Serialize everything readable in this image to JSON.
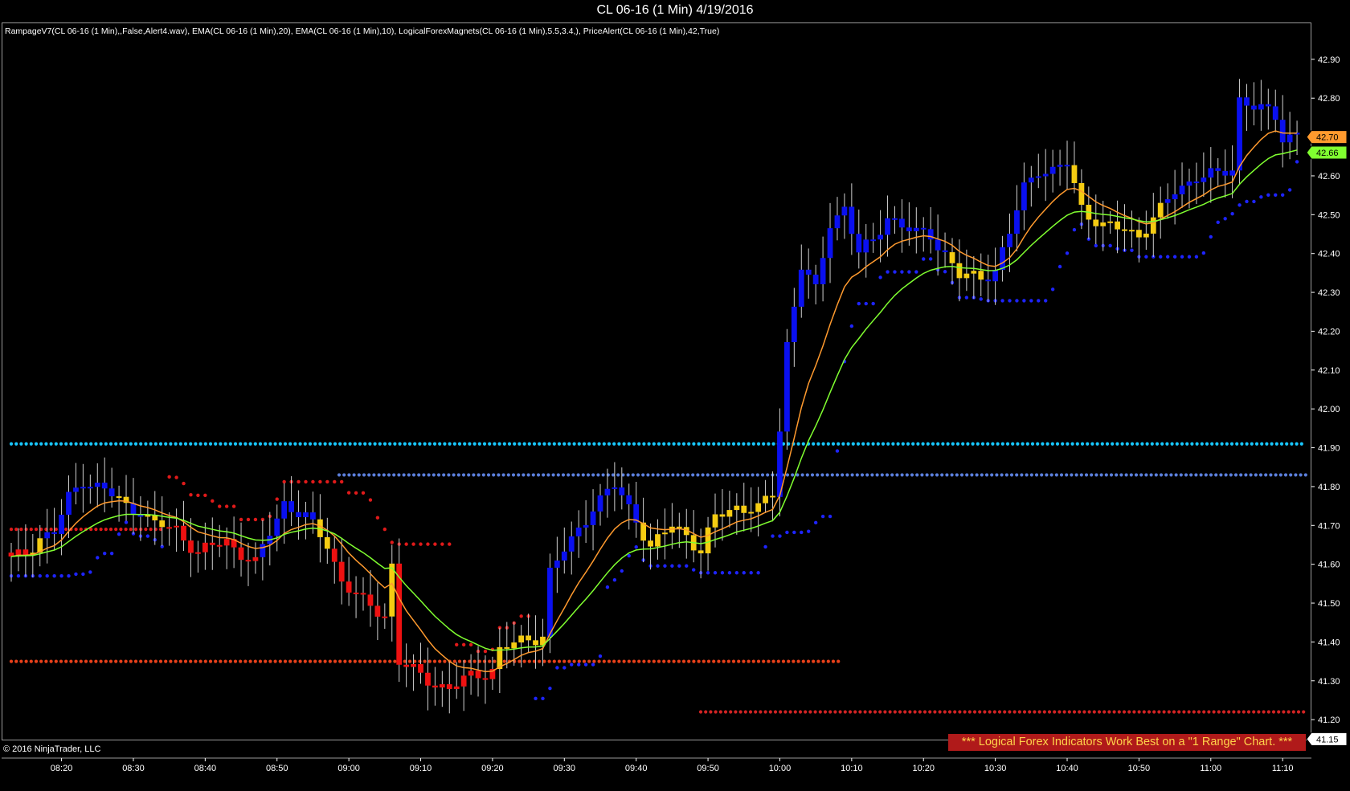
{
  "header": {
    "title": "CL 06-16 (1 Min)  4/19/2016",
    "indicators": "RampageV7(CL 06-16 (1 Min),,False,Alert4.wav), EMA(CL 06-16 (1 Min),20), EMA(CL 06-16 (1 Min),10), LogicalForexMagnets(CL 06-16 (1 Min),5.5,3.4,), PriceAlert(CL 06-16 (1 Min),42,True)"
  },
  "footer": {
    "copyright": "© 2016 NinjaTrader, LLC",
    "banner": "*** Logical Forex Indicators Work Best on a \"1 Range\" Chart. ***"
  },
  "colors": {
    "bull": "#0a10f0",
    "bear": "#ee1111",
    "neutral": "#f5cc12",
    "ema10": "#ff9a2e",
    "ema20": "#80ff30",
    "support_dots": "#1e24ff",
    "resistance_dots": "#e01a1a",
    "magnet_cyan": "#18c8ff",
    "magnet_blue": "#5b7fdc",
    "magnet_red": "#e8401a",
    "magnet_darkred": "#d22323"
  },
  "chart_data": {
    "type": "candlestick",
    "ylim": [
      41.13,
      42.97
    ],
    "y_ticks": [
      "42.90",
      "42.80",
      "42.70",
      "42.60",
      "42.50",
      "42.40",
      "42.30",
      "42.20",
      "42.10",
      "42.00",
      "41.90",
      "41.80",
      "41.70",
      "41.60",
      "41.50",
      "41.40",
      "41.30",
      "41.20"
    ],
    "x_ticks": [
      {
        "label": "08:20",
        "bar": 7
      },
      {
        "label": "08:30",
        "bar": 17
      },
      {
        "label": "08:40",
        "bar": 27
      },
      {
        "label": "08:50",
        "bar": 37
      },
      {
        "label": "09:00",
        "bar": 47
      },
      {
        "label": "09:10",
        "bar": 57
      },
      {
        "label": "09:20",
        "bar": 67
      },
      {
        "label": "09:30",
        "bar": 77
      },
      {
        "label": "09:40",
        "bar": 87
      },
      {
        "label": "09:50",
        "bar": 97
      },
      {
        "label": "10:00",
        "bar": 107
      },
      {
        "label": "10:10",
        "bar": 117
      },
      {
        "label": "10:20",
        "bar": 127
      },
      {
        "label": "10:30",
        "bar": 137
      },
      {
        "label": "10:40",
        "bar": 147
      },
      {
        "label": "10:50",
        "bar": 157
      },
      {
        "label": "11:00",
        "bar": 167
      },
      {
        "label": "11:10",
        "bar": 177
      }
    ],
    "candles_keypoints": [
      [
        0,
        41.61,
        "bear"
      ],
      [
        2,
        41.63,
        "bear"
      ],
      [
        4,
        41.67,
        "neutral"
      ],
      [
        6,
        41.68,
        "bull"
      ],
      [
        8,
        41.77,
        "bull"
      ],
      [
        10,
        41.82,
        "bull"
      ],
      [
        13,
        41.79,
        "bull"
      ],
      [
        16,
        41.75,
        "neutral"
      ],
      [
        18,
        41.74,
        "bull"
      ],
      [
        20,
        41.7,
        "neutral"
      ],
      [
        23,
        41.69,
        "bear"
      ],
      [
        26,
        41.63,
        "bear"
      ],
      [
        30,
        41.66,
        "bear"
      ],
      [
        34,
        41.6,
        "bear"
      ],
      [
        36,
        41.68,
        "bull"
      ],
      [
        38,
        41.76,
        "bull"
      ],
      [
        41,
        41.72,
        "bull"
      ],
      [
        44,
        41.65,
        "neutral"
      ],
      [
        46,
        41.56,
        "bear"
      ],
      [
        49,
        41.5,
        "bear"
      ],
      [
        52,
        41.47,
        "bear"
      ],
      [
        53,
        41.6,
        "neutral"
      ],
      [
        54,
        41.35,
        "bear"
      ],
      [
        57,
        41.31,
        "bear"
      ],
      [
        61,
        41.28,
        "bear"
      ],
      [
        64,
        41.31,
        "bear"
      ],
      [
        67,
        41.33,
        "bear"
      ],
      [
        68,
        41.38,
        "neutral"
      ],
      [
        71,
        41.4,
        "neutral"
      ],
      [
        74,
        41.42,
        "neutral"
      ],
      [
        75,
        41.58,
        "bull"
      ],
      [
        78,
        41.66,
        "bull"
      ],
      [
        81,
        41.75,
        "bull"
      ],
      [
        84,
        41.8,
        "bull"
      ],
      [
        87,
        41.72,
        "bull"
      ],
      [
        89,
        41.64,
        "neutral"
      ],
      [
        92,
        41.7,
        "neutral"
      ],
      [
        94,
        41.68,
        "neutral"
      ],
      [
        96,
        41.63,
        "neutral"
      ],
      [
        98,
        41.72,
        "neutral"
      ],
      [
        101,
        41.75,
        "neutral"
      ],
      [
        104,
        41.74,
        "neutral"
      ],
      [
        106,
        41.78,
        "neutral"
      ],
      [
        107,
        41.95,
        "bull"
      ],
      [
        108,
        42.17,
        "bull"
      ],
      [
        110,
        42.37,
        "bull"
      ],
      [
        112,
        42.3,
        "bull"
      ],
      [
        114,
        42.48,
        "bull"
      ],
      [
        116,
        42.52,
        "bull"
      ],
      [
        118,
        42.4,
        "bull"
      ],
      [
        120,
        42.43,
        "bull"
      ],
      [
        122,
        42.5,
        "bull"
      ],
      [
        124,
        42.47,
        "bull"
      ],
      [
        126,
        42.45,
        "bull"
      ],
      [
        128,
        42.45,
        "bull"
      ],
      [
        130,
        42.4,
        "bull"
      ],
      [
        132,
        42.34,
        "neutral"
      ],
      [
        135,
        42.34,
        "neutral"
      ],
      [
        137,
        42.36,
        "bull"
      ],
      [
        139,
        42.45,
        "bull"
      ],
      [
        141,
        42.57,
        "bull"
      ],
      [
        143,
        42.62,
        "bull"
      ],
      [
        145,
        42.61,
        "bull"
      ],
      [
        147,
        42.63,
        "bull"
      ],
      [
        149,
        42.52,
        "neutral"
      ],
      [
        152,
        42.47,
        "neutral"
      ],
      [
        155,
        42.46,
        "neutral"
      ],
      [
        157,
        42.45,
        "neutral"
      ],
      [
        160,
        42.51,
        "neutral"
      ],
      [
        162,
        42.56,
        "bull"
      ],
      [
        165,
        42.6,
        "bull"
      ],
      [
        168,
        42.6,
        "bull"
      ],
      [
        170,
        42.62,
        "bull"
      ],
      [
        171,
        42.8,
        "bull"
      ],
      [
        173,
        42.78,
        "bull"
      ],
      [
        176,
        42.75,
        "bull"
      ],
      [
        177,
        42.7,
        "bull"
      ]
    ],
    "price_markers": [
      {
        "label": "42.70",
        "value": 42.7,
        "color": "#ff9a2e"
      },
      {
        "label": "42.66",
        "value": 42.66,
        "color": "#80ff30"
      },
      {
        "label": "41.15",
        "value": 41.15,
        "color": "#ffffff"
      }
    ],
    "magnet_levels": [
      {
        "value": 41.91,
        "color": "#18c8ff"
      },
      {
        "value": 41.83,
        "color": "#5b7fdc"
      },
      {
        "value": 41.69,
        "color": "#e01a1a"
      },
      {
        "value": 41.35,
        "color": "#e8401a"
      },
      {
        "value": 41.22,
        "color": "#d22323"
      }
    ]
  }
}
